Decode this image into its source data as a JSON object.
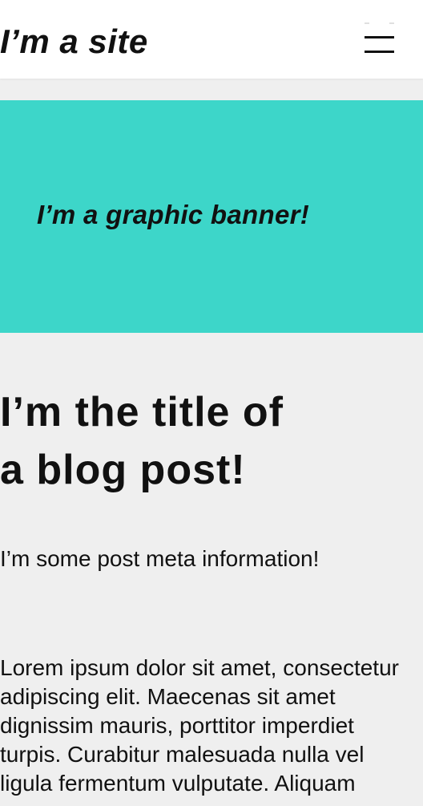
{
  "header": {
    "site_title": "I’m a site",
    "menu_icon": "hamburger-menu-icon"
  },
  "banner": {
    "text": "I’m a graphic banner!",
    "color": "#3dd6c9"
  },
  "post": {
    "title_lines": [
      "I’m the title of",
      "a blog post!"
    ],
    "meta": "I’m some post meta information!",
    "body_lines": [
      "Lorem ipsum dolor sit amet, consectetur",
      "adipiscing elit. Maecenas sit amet",
      "dignissim mauris, porttitor imperdiet",
      "turpis. Curabitur malesuada nulla vel",
      "ligula fermentum vulputate. Aliquam"
    ]
  },
  "colors": {
    "page_background": "#efefef",
    "header_background": "#ffffff",
    "text": "#111111"
  }
}
